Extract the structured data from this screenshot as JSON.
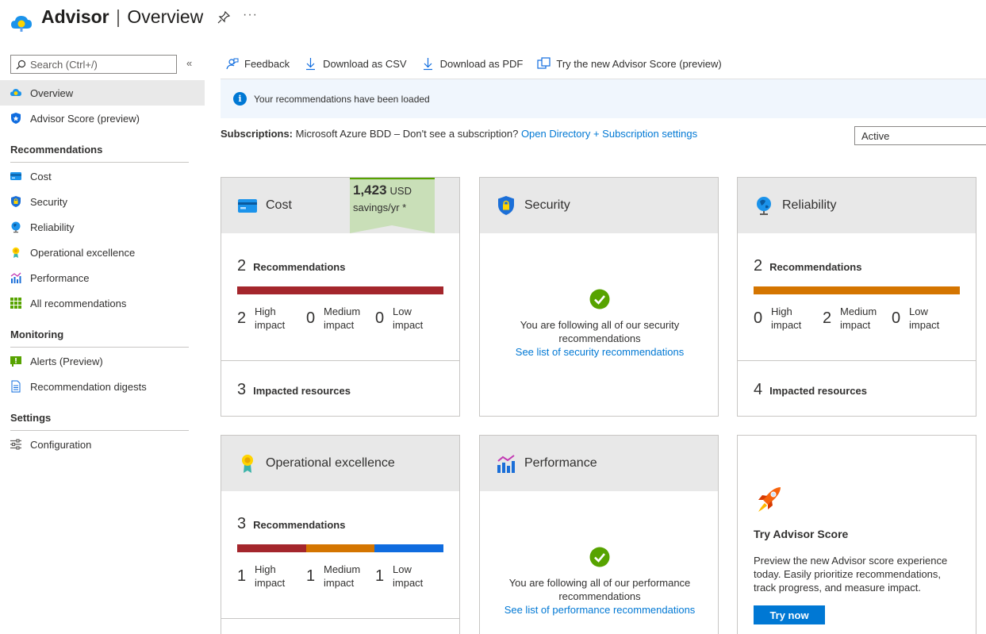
{
  "header": {
    "app": "Advisor",
    "separator": "|",
    "page": "Overview"
  },
  "sidebar": {
    "search_placeholder": "Search (Ctrl+/)",
    "collapse": "«",
    "top_items": [
      {
        "label": "Overview",
        "icon": "advisor-cloud-icon"
      },
      {
        "label": "Advisor Score (preview)",
        "icon": "score-shield-icon"
      }
    ],
    "sections": [
      {
        "title": "Recommendations",
        "items": [
          {
            "label": "Cost"
          },
          {
            "label": "Security"
          },
          {
            "label": "Reliability"
          },
          {
            "label": "Operational excellence"
          },
          {
            "label": "Performance"
          },
          {
            "label": "All recommendations"
          }
        ]
      },
      {
        "title": "Monitoring",
        "items": [
          {
            "label": "Alerts (Preview)"
          },
          {
            "label": "Recommendation digests"
          }
        ]
      },
      {
        "title": "Settings",
        "items": [
          {
            "label": "Configuration"
          }
        ]
      }
    ]
  },
  "toolbar": {
    "feedback": "Feedback",
    "csv": "Download as CSV",
    "pdf": "Download as PDF",
    "try_score": "Try the new Advisor Score (preview)"
  },
  "info": {
    "message": "Your recommendations have been loaded"
  },
  "subscriptions": {
    "label": "Subscriptions:",
    "value": "Microsoft Azure BDD – Don't see a subscription?",
    "link": "Open Directory + Subscription settings",
    "filter": "Active"
  },
  "colors": {
    "high": "#a4262c",
    "medium": "#d47500",
    "low": "#0f6cdf",
    "accent": "#0078d4",
    "ok": "#57a300"
  },
  "cards": {
    "cost": {
      "title": "Cost",
      "savings_amount": "1,423",
      "savings_currency": "USD",
      "savings_period": "savings/yr *",
      "rec_count": "2",
      "rec_label": "Recommendations",
      "high": "2",
      "medium": "0",
      "low": "0",
      "impact_high": "High",
      "impact_medium": "Medium",
      "impact_low": "Low",
      "impact_word": "impact",
      "impacted_count": "3",
      "impacted_label": "Impacted resources"
    },
    "security": {
      "title": "Security",
      "msg": "You are following all of our security recommendations",
      "link": "See list of security recommendations"
    },
    "reliability": {
      "title": "Reliability",
      "rec_count": "2",
      "rec_label": "Recommendations",
      "high": "0",
      "medium": "2",
      "low": "0",
      "impact_high": "High",
      "impact_medium": "Medium",
      "impact_low": "Low",
      "impact_word": "impact",
      "impacted_count": "4",
      "impacted_label": "Impacted resources"
    },
    "operational": {
      "title": "Operational excellence",
      "rec_count": "3",
      "rec_label": "Recommendations",
      "high": "1",
      "medium": "1",
      "low": "1",
      "impact_high": "High",
      "impact_medium": "Medium",
      "impact_low": "Low",
      "impact_word": "impact"
    },
    "performance": {
      "title": "Performance",
      "msg": "You are following all of our performance recommendations",
      "link": "See list of performance recommendations"
    },
    "score": {
      "title": "Try Advisor Score",
      "desc": "Preview the new Advisor score experience today. Easily prioritize recommendations, track progress, and measure impact.",
      "button": "Try now"
    }
  }
}
